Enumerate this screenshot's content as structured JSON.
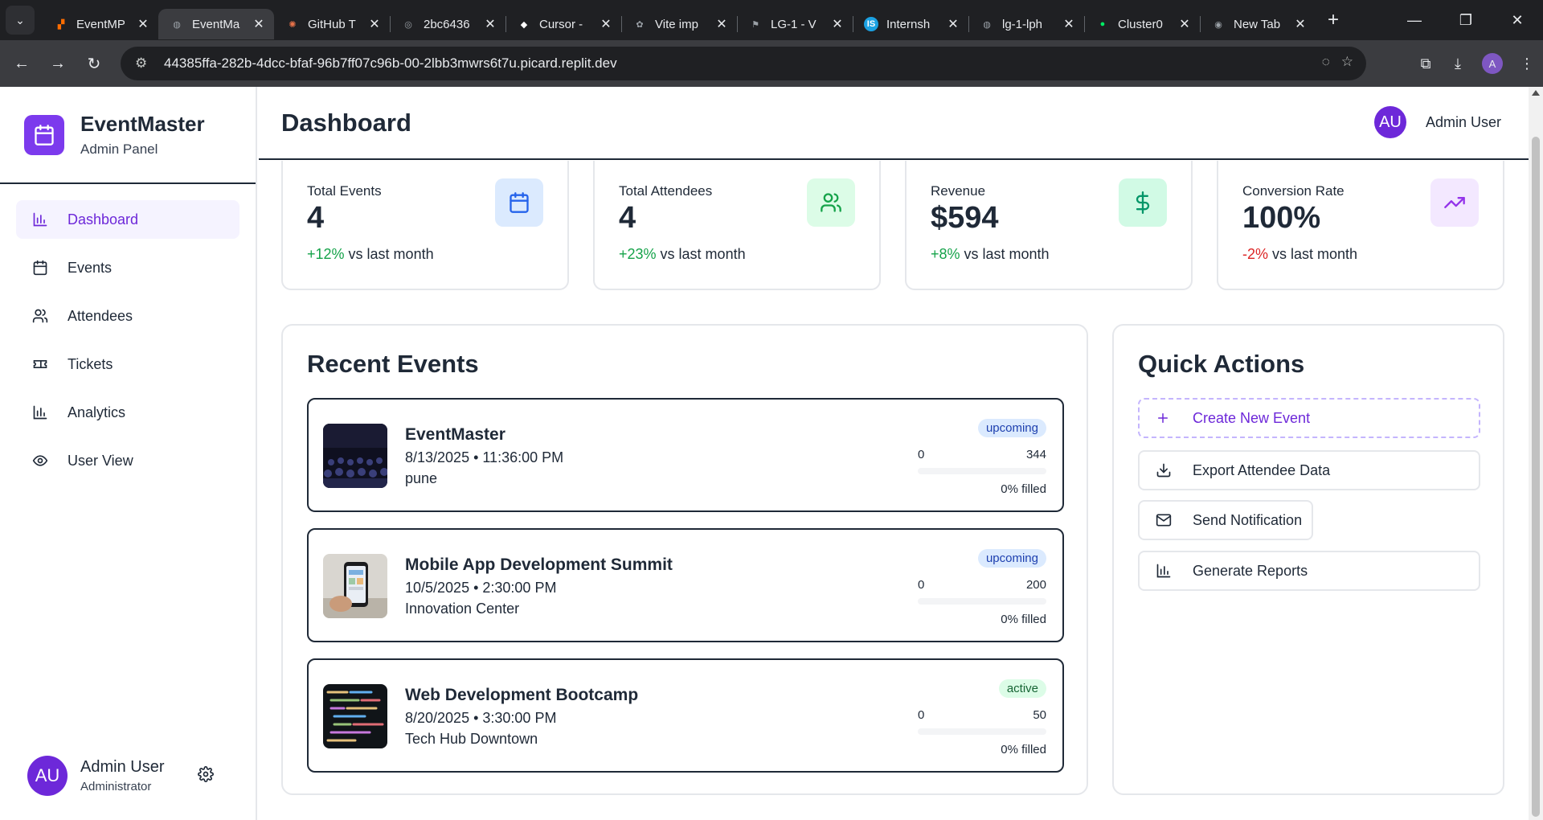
{
  "browser": {
    "tabs": [
      {
        "title": "EventMP",
        "color": "#ff6d00",
        "glyph": "▞"
      },
      {
        "title": "EventMa",
        "color": "#9aa0a6",
        "glyph": "◍",
        "active": true
      },
      {
        "title": "GitHub T",
        "color": "#e8734a",
        "glyph": "✺"
      },
      {
        "title": "2bc6436",
        "color": "#9aa0a6",
        "glyph": "◎"
      },
      {
        "title": "Cursor -",
        "color": "#ffffff",
        "glyph": "◆"
      },
      {
        "title": "Vite imp",
        "color": "#9aa0a6",
        "glyph": "✿"
      },
      {
        "title": "LG-1 - V",
        "color": "#9aa0a6",
        "glyph": "⚑"
      },
      {
        "title": "Internsh",
        "color": "#1ba1e2",
        "glyph": "IS"
      },
      {
        "title": "lg-1-lph",
        "color": "#9aa0a6",
        "glyph": "◍"
      },
      {
        "title": "Cluster0",
        "color": "#00ed64",
        "glyph": "●"
      },
      {
        "title": "New Tab",
        "color": "#9aa0a6",
        "glyph": "◉"
      }
    ],
    "url": "44385ffa-282b-4dcc-bfaf-96b7ff07c96b-00-2lbb3mwrs6t7u.picard.replit.dev",
    "profile_initial": "A"
  },
  "sidebar": {
    "brand_name": "EventMaster",
    "brand_sub": "Admin Panel",
    "items": [
      {
        "label": "Dashboard",
        "icon": "bar-chart-icon"
      },
      {
        "label": "Events",
        "icon": "calendar-icon"
      },
      {
        "label": "Attendees",
        "icon": "users-icon"
      },
      {
        "label": "Tickets",
        "icon": "ticket-icon"
      },
      {
        "label": "Analytics",
        "icon": "bar-chart-icon"
      },
      {
        "label": "User View",
        "icon": "eye-icon"
      }
    ],
    "user": {
      "initials": "AU",
      "name": "Admin User",
      "role": "Administrator"
    }
  },
  "header": {
    "title": "Dashboard",
    "user_initials": "AU",
    "user_name": "Admin User"
  },
  "stats": [
    {
      "label": "Total Events",
      "value": "4",
      "change": "+12%",
      "change_suffix": " vs last month",
      "icon": "calendar-icon",
      "icon_bg": "#dbeafe",
      "icon_color": "#2563eb",
      "positive": true
    },
    {
      "label": "Total Attendees",
      "value": "4",
      "change": "+23%",
      "change_suffix": " vs last month",
      "icon": "users-icon",
      "icon_bg": "#dcfce7",
      "icon_color": "#16a34a",
      "positive": true
    },
    {
      "label": "Revenue",
      "value": "$594",
      "change": "+8%",
      "change_suffix": " vs last month",
      "icon": "dollar-icon",
      "icon_bg": "#d1fae5",
      "icon_color": "#059669",
      "positive": true
    },
    {
      "label": "Conversion Rate",
      "value": "100%",
      "change": "-2%",
      "change_suffix": " vs last month",
      "icon": "trending-up-icon",
      "icon_bg": "#f3e8ff",
      "icon_color": "#9333ea",
      "positive": false
    }
  ],
  "recent_events": {
    "title": "Recent Events",
    "items": [
      {
        "name": "EventMaster",
        "date": "8/13/2025 • 11:36:00 PM",
        "location": "pune",
        "status": "upcoming",
        "registered": "0",
        "capacity": "344",
        "fill_fraction": 0,
        "filled": "0% filled"
      },
      {
        "name": "Mobile App Development Summit",
        "date": "10/5/2025 • 2:30:00 PM",
        "location": "Innovation Center",
        "status": "upcoming",
        "registered": "0",
        "capacity": "200",
        "fill_fraction": 0,
        "filled": "0% filled"
      },
      {
        "name": "Web Development Bootcamp",
        "date": "8/20/2025 • 3:30:00 PM",
        "location": "Tech Hub Downtown",
        "status": "active",
        "registered": "0",
        "capacity": "50",
        "fill_fraction": 0,
        "filled": "0% filled"
      }
    ]
  },
  "quick_actions": {
    "title": "Quick Actions",
    "items": [
      {
        "label": "Create New Event",
        "icon": "plus-icon"
      },
      {
        "label": "Export Attendee Data",
        "icon": "download-icon"
      },
      {
        "label": "Send Notification",
        "icon": "mail-icon"
      },
      {
        "label": "Generate Reports",
        "icon": "bar-chart-icon"
      }
    ]
  }
}
